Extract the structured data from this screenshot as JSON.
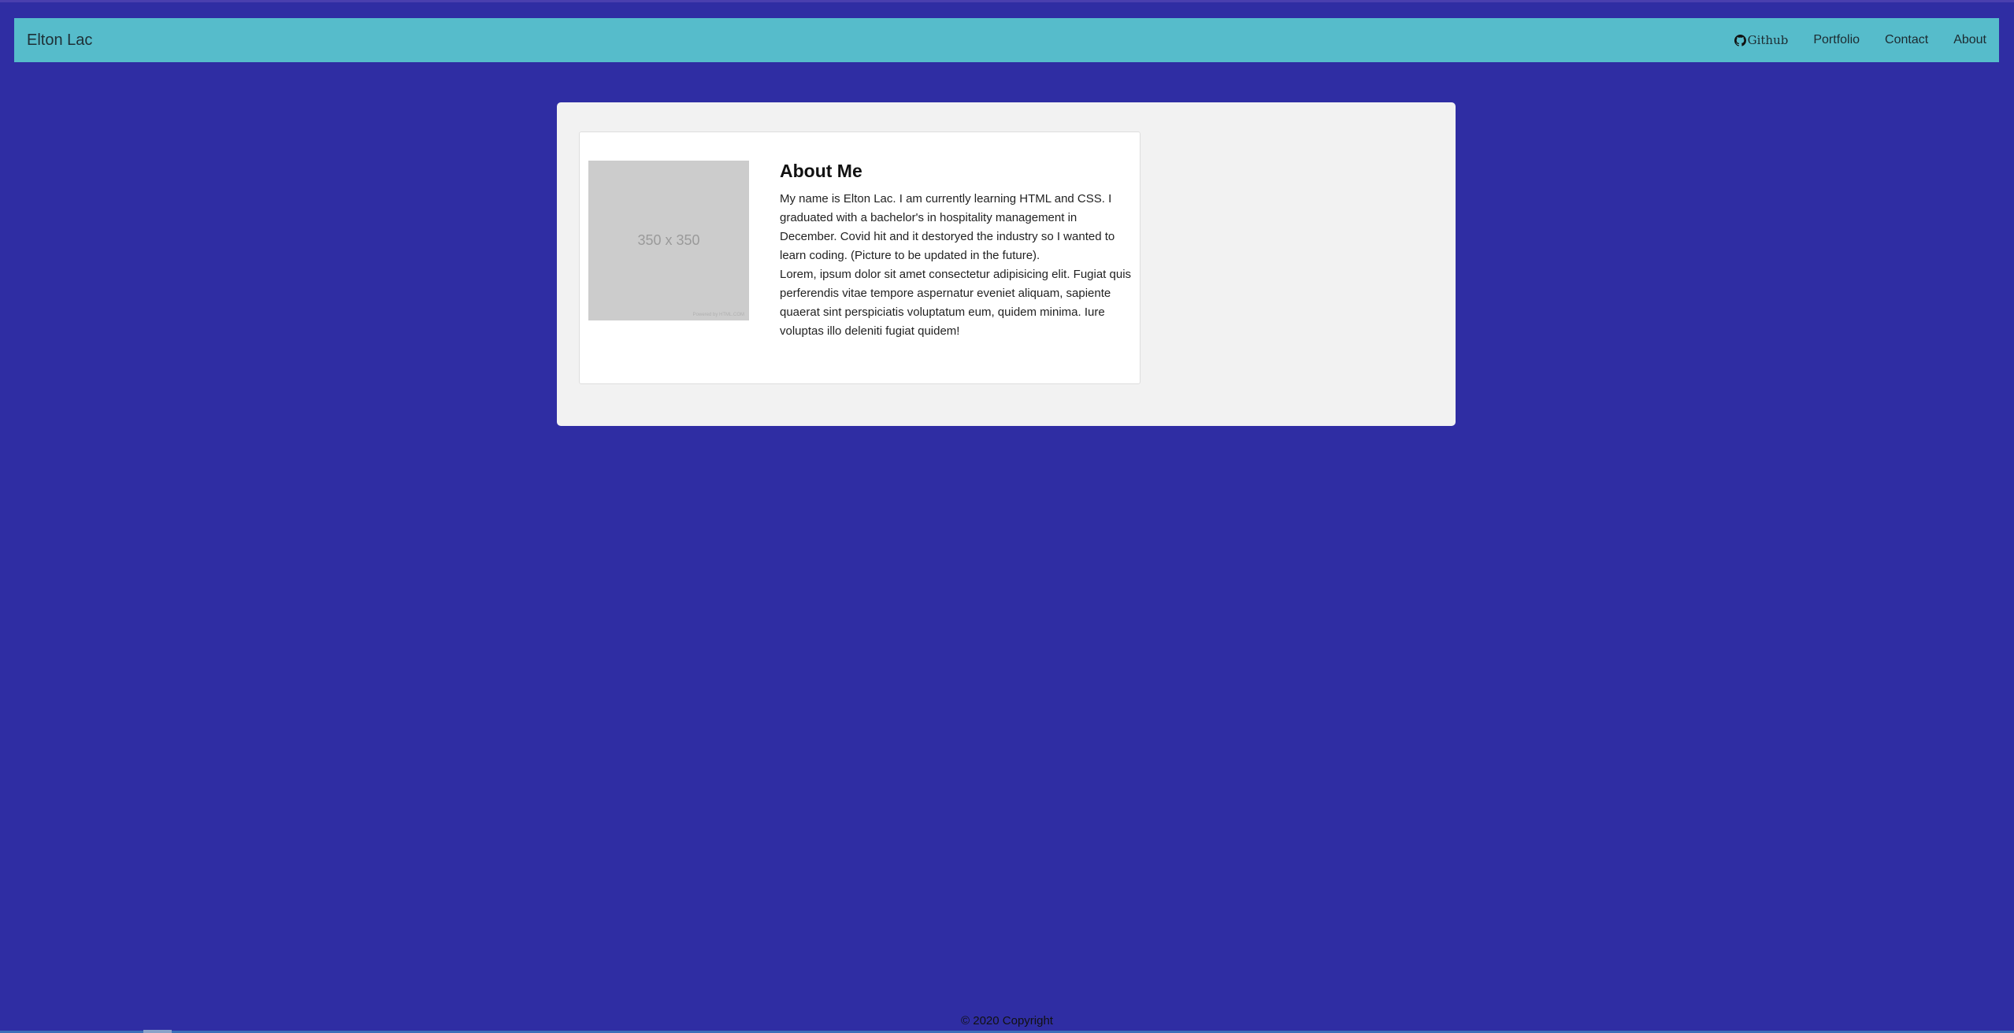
{
  "navbar": {
    "brand": "Elton Lac",
    "links": [
      {
        "label": "Github",
        "icon": "github-icon"
      },
      {
        "label": "Portfolio"
      },
      {
        "label": "Contact"
      },
      {
        "label": "About"
      }
    ]
  },
  "about": {
    "placeholder_text": "350 x 350",
    "placeholder_credit": "Powered by HTML.COM",
    "title": "About Me",
    "paragraph_1": "My name is Elton Lac. I am currently learning HTML and CSS. I graduated with a bachelor's in hospitality management in December. Covid hit and it destoryed the industry so I wanted to learn coding. (Picture to be updated in the future).",
    "paragraph_2": "Lorem, ipsum dolor sit amet consectetur adipisicing elit. Fugiat quis perferendis vitae tempore aspernatur eveniet aliquam, sapiente quaerat sint perspiciatis voluptatum eum, quidem minima. Iure voluptas illo deleniti fugiat quidem!"
  },
  "footer": {
    "copyright": "© 2020 Copyright"
  },
  "colors": {
    "page_background": "#2f2da3",
    "navbar_background": "#56bccb",
    "container_background": "#f2f2f2",
    "card_background": "#ffffff",
    "placeholder_background": "#cccccc"
  }
}
